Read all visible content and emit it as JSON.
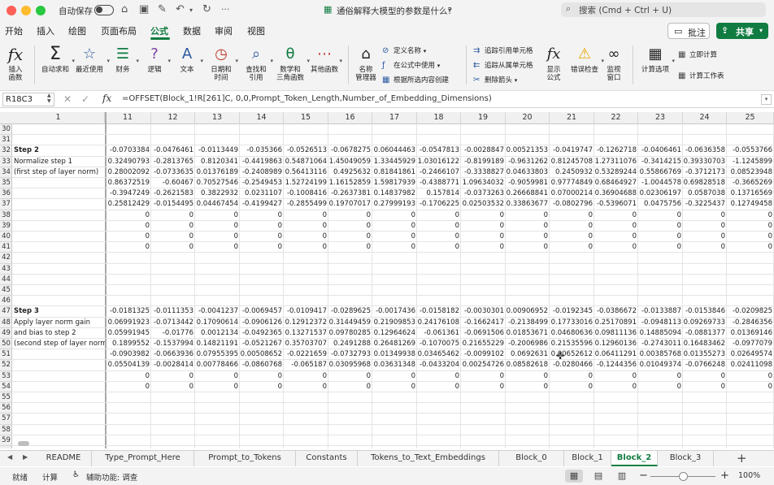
{
  "titlebar": {
    "autosave_label": "自动保存",
    "doc_title": "通俗解释大模型的参数是什么?",
    "search_placeholder": "搜索 (Cmd + Ctrl + U)"
  },
  "menu": {
    "tabs": [
      "开始",
      "插入",
      "绘图",
      "页面布局",
      "公式",
      "数据",
      "审阅",
      "视图"
    ],
    "active_tab": "公式",
    "comment_label": "批注",
    "share_label": "共享"
  },
  "ribbon": {
    "insert_function": "插入\n函数",
    "autosum": "自动求和",
    "recent": "最近使用",
    "financial": "财务",
    "logical": "逻辑",
    "text": "文本",
    "datetime": "日期和\n时间",
    "lookup": "查找和\n引用",
    "math": "数学和\n三角函数",
    "more": "其他函数",
    "name_manager": "名称\n管理器",
    "define_name": "定义名称",
    "use_in_formula": "在公式中使用",
    "create_from_selection": "根据所选内容创建",
    "trace_precedents": "追踪引用单元格",
    "trace_dependents": "追踪从属单元格",
    "remove_arrows": "删除箭头",
    "show_formulas": "显示\n公式",
    "error_check": "错误检查",
    "watch_window": "监视\n窗口",
    "calc_options": "计算选项",
    "calc_now": "立即计算",
    "calc_sheet": "计算工作表"
  },
  "formula_bar": {
    "name_box": "R18C3",
    "formula": "=OFFSET(Block_1!R[261]C, 0,0,Prompt_Token_Length,Number_of_Embedding_Dimensions)"
  },
  "grid": {
    "col_headers": [
      "1",
      "11",
      "12",
      "13",
      "14",
      "15",
      "16",
      "17",
      "18",
      "19",
      "20",
      "21",
      "22",
      "23",
      "24",
      "25"
    ],
    "row_headers": [
      "30",
      "31",
      "32",
      "33",
      "34",
      "35",
      "36",
      "37",
      "38",
      "39",
      "40",
      "41",
      "42",
      "43",
      "44",
      "45",
      "46",
      "47",
      "48",
      "49",
      "50",
      "51",
      "52",
      "53",
      "54",
      "55",
      "56",
      "57",
      "58",
      "59"
    ],
    "labels": {
      "r32": "Step 2",
      "r33": "Normalize step 1",
      "r34": "(first step of layer norm)",
      "r47": "Step 3",
      "r48": "Apply layer norm gain",
      "r49": "and bias to step 2",
      "r50": "(second step of layer norm)"
    },
    "rows": {
      "r32": [
        "-0.0703384",
        "-0.0476461",
        "-0.0113449",
        "-0.035366",
        "-0.0526513",
        "-0.0678275",
        "0.06044463",
        "-0.0547813",
        "-0.0028847",
        "0.00521353",
        "-0.0419747",
        "-0.1262718",
        "-0.0406461",
        "-0.0636358",
        "-0.0553766"
      ],
      "r33": [
        "0.32490793",
        "-0.2813765",
        "0.8120341",
        "-0.4419863",
        "0.54871064",
        "1.45049059",
        "1.33445929",
        "1.03016122",
        "-0.8199189",
        "-0.9631262",
        "0.81245708",
        "1.27311076",
        "-0.3414215",
        "0.39330703",
        "-1.1245899"
      ],
      "r34": [
        "0.28002092",
        "-0.0733635",
        "0.01376189",
        "-0.2408989",
        "0.56413116",
        "0.4925632",
        "0.81841861",
        "-0.2466107",
        "-0.3338827",
        "0.04633803",
        "0.2450932",
        "0.53289244",
        "0.55866769",
        "-0.3712173",
        "0.08523948"
      ],
      "r35": [
        "0.86372519",
        "-0.60467",
        "0.70527546",
        "-0.2549453",
        "1.52724199",
        "1.16152859",
        "1.59817939",
        "-0.4388771",
        "1.09634032",
        "-0.9059981",
        "0.97774849",
        "0.68464927",
        "-1.0044578",
        "0.69828518",
        "-0.3665269"
      ],
      "r36": [
        "-0.3947249",
        "-0.2621583",
        "0.3822932",
        "0.0231107",
        "-0.1008416",
        "-0.2637381",
        "0.14837982",
        "0.157814",
        "-0.0373263",
        "0.26668841",
        "0.07000214",
        "0.36904688",
        "0.02306197",
        "0.0587038",
        "0.13716569"
      ],
      "r37": [
        "0.25812429",
        "-0.0154495",
        "0.04467454",
        "-0.4199427",
        "-0.2855499",
        "0.19707017",
        "0.27999193",
        "-0.1706225",
        "0.02503532",
        "0.33863677",
        "-0.0802796",
        "-0.5396071",
        "0.0475756",
        "-0.3225437",
        "0.12749458"
      ],
      "r38": [
        "0",
        "0",
        "0",
        "0",
        "0",
        "0",
        "0",
        "0",
        "0",
        "0",
        "0",
        "0",
        "0",
        "0",
        "0"
      ],
      "r39": [
        "0",
        "0",
        "0",
        "0",
        "0",
        "0",
        "0",
        "0",
        "0",
        "0",
        "0",
        "0",
        "0",
        "0",
        "0"
      ],
      "r40": [
        "0",
        "0",
        "0",
        "0",
        "0",
        "0",
        "0",
        "0",
        "0",
        "0",
        "0",
        "0",
        "0",
        "0",
        "0"
      ],
      "r41": [
        "0",
        "0",
        "0",
        "0",
        "0",
        "0",
        "0",
        "0",
        "0",
        "0",
        "0",
        "0",
        "0",
        "0",
        "0"
      ],
      "r47": [
        "-0.0181325",
        "-0.0111353",
        "-0.0041237",
        "-0.0069457",
        "-0.0109417",
        "-0.0289625",
        "-0.0017436",
        "-0.0158182",
        "-0.0030301",
        "0.00906952",
        "-0.0192345",
        "-0.0386672",
        "-0.0133887",
        "-0.0153846",
        "-0.0209825"
      ],
      "r48": [
        "0.06991923",
        "-0.0713442",
        "0.17090614",
        "-0.0906126",
        "0.12912372",
        "0.31449459",
        "0.21909853",
        "0.24176108",
        "-0.1662417",
        "-0.2138499",
        "0.17733016",
        "0.25170891",
        "-0.0948113",
        "0.09269733",
        "-0.2846356"
      ],
      "r49": [
        "0.05991945",
        "-0.01776",
        "0.0012134",
        "-0.0492365",
        "0.13271537",
        "0.09780285",
        "0.12964624",
        "-0.061361",
        "-0.0691506",
        "0.01853671",
        "0.04680636",
        "0.09811136",
        "0.14885094",
        "-0.0881377",
        "0.01369146"
      ],
      "r50": [
        "0.1899552",
        "-0.1537994",
        "0.14821191",
        "-0.0521267",
        "0.35703707",
        "0.2491288",
        "0.26481269",
        "-0.1070075",
        "0.21655229",
        "-0.2006986",
        "0.21535596",
        "0.12960136",
        "-0.2743011",
        "0.16483462",
        "-0.0977079"
      ],
      "r51": [
        "-0.0903982",
        "-0.0663936",
        "0.07955395",
        "0.00508652",
        "-0.0221659",
        "-0.0732793",
        "0.01349938",
        "0.03465462",
        "-0.0099102",
        "0.0692631",
        "0.00652612",
        "0.06411291",
        "0.00385768",
        "0.01355273",
        "0.02649574"
      ],
      "r52": [
        "0.05504139",
        "-0.0028414",
        "0.00778466",
        "-0.0860768",
        "-0.065187",
        "0.03095968",
        "0.03631348",
        "-0.0433204",
        "0.00254726",
        "0.08582618",
        "-0.0280466",
        "-0.1244356",
        "0.01049374",
        "-0.0766248",
        "0.02411098"
      ],
      "r53": [
        "0",
        "0",
        "0",
        "0",
        "0",
        "0",
        "0",
        "0",
        "0",
        "0",
        "0",
        "0",
        "0",
        "0",
        "0"
      ],
      "r54": [
        "0",
        "0",
        "0",
        "0",
        "0",
        "0",
        "0",
        "0",
        "0",
        "0",
        "0",
        "0",
        "0",
        "0",
        "0"
      ]
    }
  },
  "sheets": {
    "tabs": [
      "README",
      "Type_Prompt_Here",
      "Prompt_to_Tokens",
      "Constants",
      "Tokens_to_Text_Embeddings",
      "Block_0",
      "Block_1",
      "Block_2",
      "Block_3"
    ],
    "active": "Block_2"
  },
  "status": {
    "ready": "就绪",
    "calc": "计算",
    "accessibility": "辅助功能: 调查",
    "zoom": "100%"
  },
  "colors": {
    "accent": "#107c41"
  }
}
